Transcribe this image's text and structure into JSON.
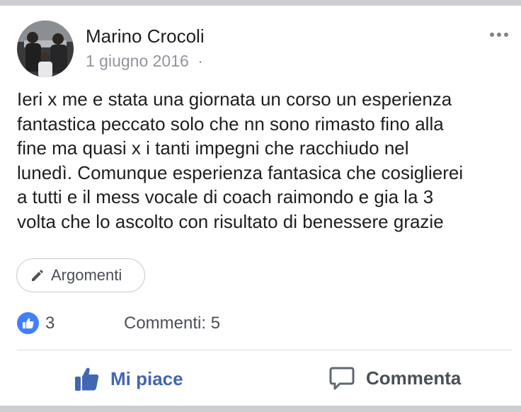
{
  "post": {
    "author": "Marino Crocoli",
    "date": "1 giugno 2016",
    "date_separator": "·",
    "text": "Ieri x me e stata una giornata un corso un esperienza\nfantastica peccato solo che nn sono rimasto fino alla\nfine ma quasi x i tanti impegni che racchiudo nel\nlunedì. Comunque esperienza fantasica che cosiglierei\na tutti e il mess vocale di coach raimondo e gia la 3\nvolta che lo ascolto con risultato di benessere grazie",
    "topic_label": "Argomenti"
  },
  "stats": {
    "likes": "3",
    "comments": "Commenti: 5"
  },
  "actions": {
    "like_label": "Mi piace",
    "comment_label": "Commenta"
  },
  "colors": {
    "accent": "#4267b2",
    "like_badge": "#4080ff",
    "text": "#1c1e21",
    "muted": "#90949c",
    "separator": "#cdced2"
  },
  "icons": {
    "more": "more-horizontal-icon",
    "topic": "pencil-icon",
    "like_badge": "thumbs-up-icon",
    "like_button": "thumbs-up-icon",
    "comment_button": "speech-bubble-icon"
  }
}
